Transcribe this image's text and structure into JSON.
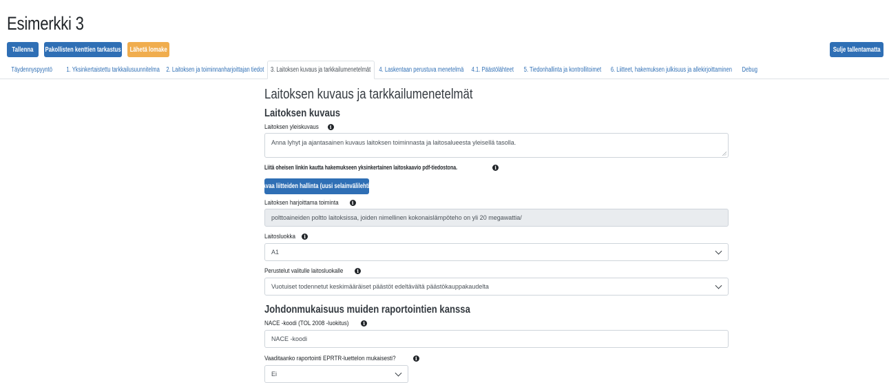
{
  "page": {
    "title": "Esimerkki 3"
  },
  "toolbar": {
    "save_label": "Tallenna",
    "check_label": "Pakollisten kenttien tarkastus",
    "send_label": "Lähetä lomake",
    "close_label": "Sulje tallentamatta"
  },
  "tabs": [
    {
      "label": "Täydennyspyyntö"
    },
    {
      "label": "1. Yksinkertaistettu tarkkailusuunnitelma"
    },
    {
      "label": "2. Laitoksen ja toiminnanharjoittajan tiedot"
    },
    {
      "label": "3. Laitoksen kuvaus ja tarkkailumenetelmät"
    },
    {
      "label": "4. Laskentaan perustuva menetelmä"
    },
    {
      "label": "4.1. Päästölähteet"
    },
    {
      "label": "5. Tiedonhallinta ja kontrollitoimet"
    },
    {
      "label": "6. Liitteet, hakemuksen julkisuus ja allekirjoittaminen"
    },
    {
      "label": "Debug"
    }
  ],
  "section": {
    "title": "Laitoksen kuvaus ja tarkkailumenetelmät",
    "subtitle": "Laitoksen kuvaus",
    "general_label": "Laitoksen yleiskuvaus",
    "general_placeholder": "Anna lyhyt ja ajantasainen kuvaus laitoksen toiminnasta ja laitosalueesta yleisellä tasolla.",
    "attach_label": "Liitä oheisen linkin kautta hakemukseen yksinkertainen laitoskaavio pdf-tiedostona.",
    "attach_button": "Avaa liitteiden hallinta (uusi selainvälilehti)",
    "activity_label": "Laitoksen harjoittama toiminta",
    "activity_value": "polttoaineiden poltto laitoksissa, joiden nimellinen kokonaislämpöteho on yli 20 megawattia/",
    "class_label": "Laitosluokka",
    "class_value": "A1",
    "reason_label": "Perustelut valitulle laitosluokalle",
    "reason_value": "Vuotuiset todennetut keskimääräiset päästöt edeltävältä päästökauppakaudelta"
  },
  "consistency": {
    "title": "Johdonmukaisuus muiden raportointien kanssa",
    "nace_label": "NACE -koodi (TOL 2008 -luokitus)",
    "nace_placeholder": "NACE -koodi",
    "eprtr_label": "Vaaditaanko raportointi EPRTR-luettelon mukaisesti?",
    "eprtr_value": "Ei"
  },
  "icons": {
    "info": "info-icon",
    "dropdown": "chevron-down-icon",
    "resize": "resize-handle-icon"
  },
  "colors": {
    "primary": "#2f6fb5",
    "warning": "#f0ad4e",
    "readonly": "#e9ecef"
  }
}
